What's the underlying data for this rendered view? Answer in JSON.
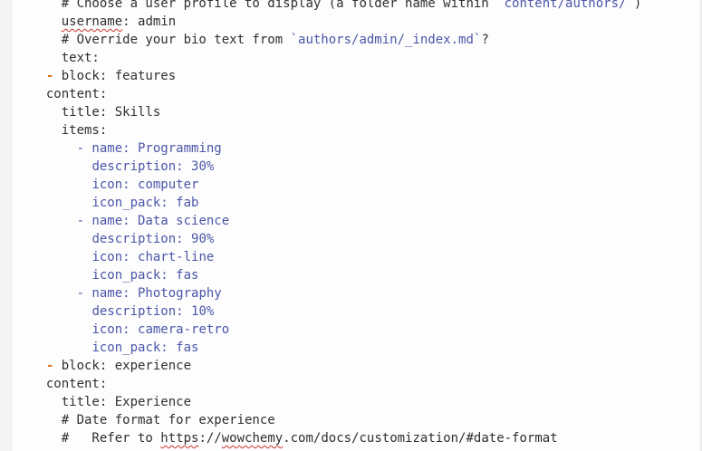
{
  "editor": {
    "lines": [
      {
        "indent": "    ",
        "segs": [
          {
            "t": "# Choose a user profile to display (a folder name within ",
            "c": "default"
          },
          {
            "t": "`content/authors/`",
            "c": "code"
          },
          {
            "t": ")",
            "c": "default"
          }
        ]
      },
      {
        "indent": "    ",
        "segs": [
          {
            "t": "username",
            "c": "default",
            "spell": true
          },
          {
            "t": ": admin",
            "c": "default"
          }
        ]
      },
      {
        "indent": "    ",
        "segs": [
          {
            "t": "# Override your bio text from ",
            "c": "default"
          },
          {
            "t": "`authors/admin/_index.md`",
            "c": "code"
          },
          {
            "t": "?",
            "c": "default"
          }
        ]
      },
      {
        "indent": "    ",
        "segs": [
          {
            "t": "text:",
            "c": "default"
          }
        ]
      },
      {
        "indent": "  ",
        "segs": [
          {
            "t": "- ",
            "c": "dash"
          },
          {
            "t": "block: features",
            "c": "default"
          }
        ]
      },
      {
        "indent": "  ",
        "segs": [
          {
            "t": "content:",
            "c": "default"
          }
        ]
      },
      {
        "indent": "    ",
        "segs": [
          {
            "t": "title: Skills",
            "c": "default"
          }
        ]
      },
      {
        "indent": "    ",
        "segs": [
          {
            "t": "items:",
            "c": "default"
          }
        ]
      },
      {
        "indent": "      ",
        "segs": [
          {
            "t": "- name: Programming",
            "c": "blue"
          }
        ]
      },
      {
        "indent": "        ",
        "segs": [
          {
            "t": "description: 30%",
            "c": "blue"
          }
        ]
      },
      {
        "indent": "        ",
        "segs": [
          {
            "t": "icon: computer",
            "c": "blue"
          }
        ]
      },
      {
        "indent": "        ",
        "segs": [
          {
            "t": "icon_pack: fab",
            "c": "blue"
          }
        ]
      },
      {
        "indent": "      ",
        "segs": [
          {
            "t": "- name: Data science",
            "c": "blue"
          }
        ]
      },
      {
        "indent": "        ",
        "segs": [
          {
            "t": "description: 90%",
            "c": "blue"
          }
        ]
      },
      {
        "indent": "        ",
        "segs": [
          {
            "t": "icon: chart-line",
            "c": "blue"
          }
        ]
      },
      {
        "indent": "        ",
        "segs": [
          {
            "t": "icon_pack: fas",
            "c": "blue"
          }
        ]
      },
      {
        "indent": "      ",
        "segs": [
          {
            "t": "- name: Photography",
            "c": "blue"
          }
        ]
      },
      {
        "indent": "        ",
        "segs": [
          {
            "t": "description: 10%",
            "c": "blue"
          }
        ]
      },
      {
        "indent": "        ",
        "segs": [
          {
            "t": "icon: camera-retro",
            "c": "blue"
          }
        ]
      },
      {
        "indent": "        ",
        "segs": [
          {
            "t": "icon_pack: fas",
            "c": "blue"
          }
        ]
      },
      {
        "indent": "  ",
        "segs": [
          {
            "t": "- ",
            "c": "dash"
          },
          {
            "t": "block: experience",
            "c": "default"
          }
        ]
      },
      {
        "indent": "  ",
        "segs": [
          {
            "t": "content:",
            "c": "default"
          }
        ]
      },
      {
        "indent": "    ",
        "segs": [
          {
            "t": "title: Experience",
            "c": "default"
          }
        ]
      },
      {
        "indent": "    ",
        "segs": [
          {
            "t": "# Date format for experience",
            "c": "default"
          }
        ]
      },
      {
        "indent": "    ",
        "segs": [
          {
            "t": "#   Refer to ",
            "c": "default"
          },
          {
            "t": "https",
            "c": "default",
            "spell": true
          },
          {
            "t": "://",
            "c": "default"
          },
          {
            "t": "wowchemy",
            "c": "default",
            "spell": true
          },
          {
            "t": ".com/docs/customization/#date-format",
            "c": "default"
          }
        ]
      }
    ]
  }
}
